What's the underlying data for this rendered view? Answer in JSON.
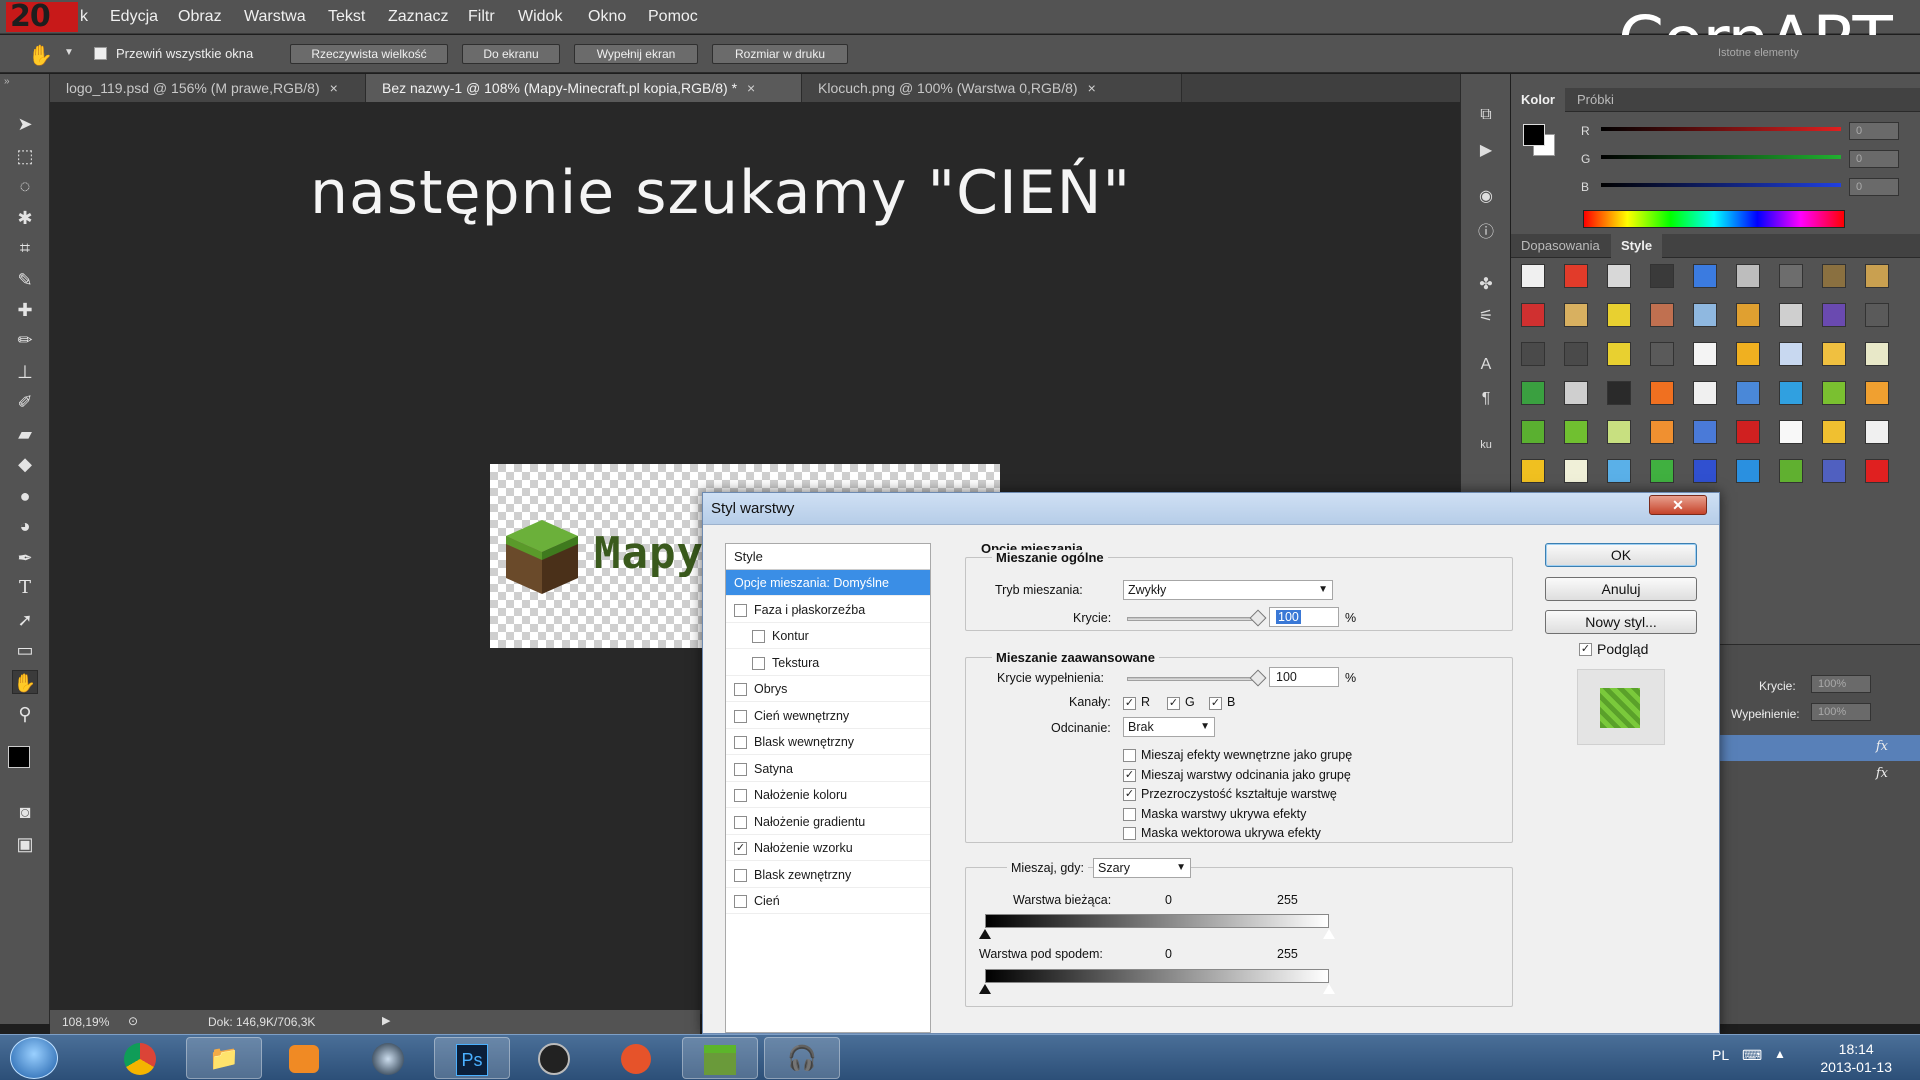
{
  "watermark": "CornART",
  "menu": {
    "logo": "20",
    "partial": "k",
    "items": [
      "Edycja",
      "Obraz",
      "Warstwa",
      "Tekst",
      "Zaznacz",
      "Filtr",
      "Widok",
      "Okno",
      "Pomoc"
    ]
  },
  "options": {
    "scroll_all_label": "Przewiń wszystkie okna",
    "buttons": [
      "Rzeczywista wielkość",
      "Do ekranu",
      "Wypełnij ekran",
      "Rozmiar w druku"
    ],
    "workspace": "Istotne elementy"
  },
  "tabs": [
    {
      "label": "logo_119.psd @ 156% (M prawe,RGB/8)",
      "close": "×"
    },
    {
      "label": "Bez nazwy-1 @ 108% (Mapy-Minecraft.pl kopia,RGB/8) *",
      "close": "×"
    },
    {
      "label": "Klocuch.png @ 100% (Warstwa 0,RGB/8)",
      "close": "×"
    }
  ],
  "canvas": {
    "headline": "następnie szukamy \"CIEŃ\"",
    "logo_text": "Mapy"
  },
  "status": {
    "zoom": "108,19%",
    "doc": "Dok: 146,9K/706,3K"
  },
  "color_panel": {
    "tabs": [
      "Kolor",
      "Próbki"
    ],
    "channels": [
      {
        "label": "R",
        "value": "0",
        "color": "#e02020"
      },
      {
        "label": "G",
        "value": "0",
        "color": "#20b030"
      },
      {
        "label": "B",
        "value": "0",
        "color": "#2040e0"
      }
    ]
  },
  "styles_panel": {
    "tabs": [
      "Dopasowania",
      "Style"
    ]
  },
  "layers_panel": {
    "opacity_label": "Krycie:",
    "opacity": "100%",
    "fill_label": "Wypełnienie:",
    "fill": "100%",
    "fx": "fx"
  },
  "dialog": {
    "title": "Styl warstwy",
    "close": "✕",
    "list_header": "Style",
    "list": [
      {
        "label": "Opcje mieszania: Domyślne",
        "checkbox": false,
        "checked": false,
        "indent": 0,
        "selected": true
      },
      {
        "label": "Faza i płaskorzeźba",
        "checkbox": true,
        "checked": false,
        "indent": 0
      },
      {
        "label": "Kontur",
        "checkbox": true,
        "checked": false,
        "indent": 1
      },
      {
        "label": "Tekstura",
        "checkbox": true,
        "checked": false,
        "indent": 1
      },
      {
        "label": "Obrys",
        "checkbox": true,
        "checked": false,
        "indent": 0
      },
      {
        "label": "Cień wewnętrzny",
        "checkbox": true,
        "checked": false,
        "indent": 0
      },
      {
        "label": "Blask wewnętrzny",
        "checkbox": true,
        "checked": false,
        "indent": 0
      },
      {
        "label": "Satyna",
        "checkbox": true,
        "checked": false,
        "indent": 0
      },
      {
        "label": "Nałożenie koloru",
        "checkbox": true,
        "checked": false,
        "indent": 0
      },
      {
        "label": "Nałożenie gradientu",
        "checkbox": true,
        "checked": false,
        "indent": 0
      },
      {
        "label": "Nałożenie wzorku",
        "checkbox": true,
        "checked": true,
        "indent": 0
      },
      {
        "label": "Blask zewnętrzny",
        "checkbox": true,
        "checked": false,
        "indent": 0
      },
      {
        "label": "Cień",
        "checkbox": true,
        "checked": false,
        "indent": 0
      }
    ],
    "blend_options_title": "Opcje mieszania",
    "general": {
      "title": "Mieszanie ogólne",
      "mode_label": "Tryb mieszania:",
      "mode_value": "Zwykły",
      "opacity_label": "Krycie:",
      "opacity_value": "100",
      "pct": "%"
    },
    "advanced": {
      "title": "Mieszanie zaawansowane",
      "fill_label": "Krycie wypełnienia:",
      "fill_value": "100",
      "pct": "%",
      "channels_label": "Kanały:",
      "channels": [
        {
          "label": "R",
          "checked": true
        },
        {
          "label": "G",
          "checked": true
        },
        {
          "label": "B",
          "checked": true
        }
      ],
      "knockout_label": "Odcinanie:",
      "knockout_value": "Brak",
      "options": [
        {
          "label": "Mieszaj efekty wewnętrzne jako grupę",
          "checked": false
        },
        {
          "label": "Mieszaj warstwy odcinania jako grupę",
          "checked": true
        },
        {
          "label": "Przezroczystość kształtuje warstwę",
          "checked": true
        },
        {
          "label": "Maska warstwy ukrywa efekty",
          "checked": false
        },
        {
          "label": "Maska wektorowa ukrywa efekty",
          "checked": false
        }
      ]
    },
    "blend_if": {
      "label": "Mieszaj, gdy:",
      "value": "Szary",
      "current_label": "Warstwa bieżąca:",
      "current_min": "0",
      "current_max": "255",
      "under_label": "Warstwa pod spodem:",
      "under_min": "0",
      "under_max": "255"
    },
    "buttons": {
      "ok": "OK",
      "cancel": "Anuluj",
      "new_style": "Nowy styl..."
    },
    "preview_label": "Podgląd",
    "preview_checked": true
  },
  "taskbar": {
    "apps": [
      "chrome",
      "explorer",
      "media-player",
      "app-circle",
      "photoshop",
      "steam",
      "app-orange",
      "app-minecraft",
      "headphones-app"
    ],
    "ps_label": "Ps",
    "lang": "PL",
    "time": "18:14",
    "date": "2013-01-13"
  }
}
